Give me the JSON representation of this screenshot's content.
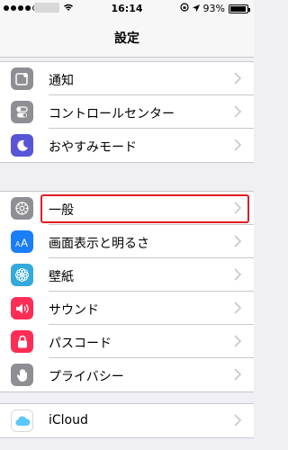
{
  "status_bar": {
    "time": "16:14",
    "battery": "93%",
    "battery_level": 0.93,
    "icons": [
      "signal-dots-icon",
      "wifi-icon",
      "rotation-lock-icon",
      "location-arrow-icon",
      "battery-icon"
    ]
  },
  "nav": {
    "title": "設定"
  },
  "groups": [
    {
      "items": [
        {
          "label": "通知",
          "icon": "notifications-icon",
          "color": "#8e8e93"
        },
        {
          "label": "コントロールセンター",
          "icon": "control-center-icon",
          "color": "#8e8e93"
        },
        {
          "label": "おやすみモード",
          "icon": "moon-icon",
          "color": "#5856d6"
        }
      ]
    },
    {
      "items": [
        {
          "label": "一般",
          "icon": "gear-icon",
          "color": "#8e8e93",
          "highlighted": true
        },
        {
          "label": "画面表示と明るさ",
          "icon": "display-aa-icon",
          "color": "#1a7ef7"
        },
        {
          "label": "壁紙",
          "icon": "wallpaper-flower-icon",
          "color": "#34aadc"
        },
        {
          "label": "サウンド",
          "icon": "speaker-icon",
          "color": "#ff2d55"
        },
        {
          "label": "パスコード",
          "icon": "lock-icon",
          "color": "#ff2d55"
        },
        {
          "label": "プライバシー",
          "icon": "hand-icon",
          "color": "#8e8e93"
        }
      ]
    },
    {
      "items": [
        {
          "label": "iCloud",
          "icon": "icloud-icon",
          "color": "#ffffff"
        }
      ]
    }
  ]
}
